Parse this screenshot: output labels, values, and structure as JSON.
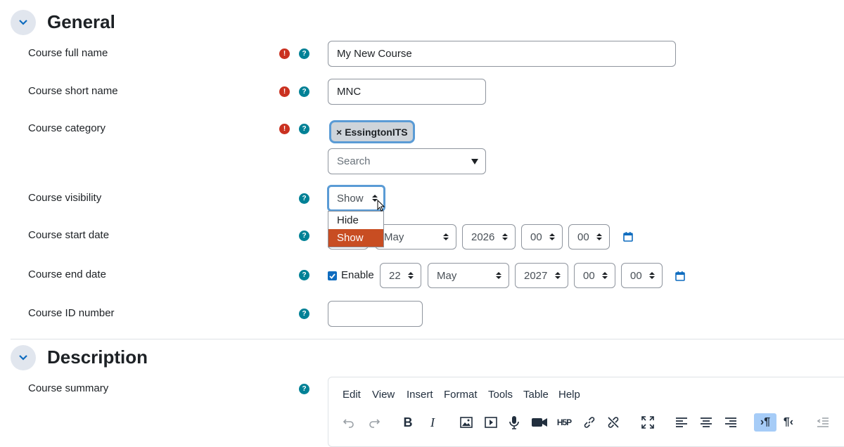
{
  "general": {
    "title": "General",
    "fields": {
      "fullname": {
        "label": "Course full name",
        "value": "My New Course"
      },
      "shortname": {
        "label": "Course short name",
        "value": "MNC"
      },
      "category": {
        "label": "Course category",
        "selected_badge": "EssingtonITS",
        "badge_remove": "×",
        "search_placeholder": "Search"
      },
      "visibility": {
        "label": "Course visibility",
        "value": "Show",
        "options": [
          "Hide",
          "Show"
        ],
        "highlighted_option": "Show"
      },
      "startdate": {
        "label": "Course start date",
        "month": "May",
        "year": "2026",
        "hour": "00",
        "minute": "00"
      },
      "enddate": {
        "label": "Course end date",
        "enable_label": "Enable",
        "enabled": true,
        "day": "22",
        "month": "May",
        "year": "2027",
        "hour": "00",
        "minute": "00"
      },
      "idnumber": {
        "label": "Course ID number",
        "value": ""
      }
    }
  },
  "description": {
    "title": "Description",
    "summary_label": "Course summary",
    "editor_menu": [
      "Edit",
      "View",
      "Insert",
      "Format",
      "Tools",
      "Table",
      "Help"
    ],
    "toolbar_icons": [
      "undo-icon",
      "redo-icon",
      "bold-icon",
      "italic-icon",
      "image-icon",
      "media-icon",
      "microphone-icon",
      "video-icon",
      "h5p-icon",
      "link-icon",
      "unlink-icon",
      "fullscreen-icon",
      "align-left-icon",
      "align-center-icon",
      "align-right-icon",
      "ltr-icon",
      "rtl-icon",
      "outdent-icon"
    ],
    "h5p_text": "H5P"
  },
  "icons": {
    "required": "!",
    "help": "?",
    "collapse": "chevron-down-icon",
    "calendar": "calendar-icon"
  },
  "colors": {
    "accent": "#0f6cbf",
    "required": "#ca3120",
    "help": "#008196",
    "highlight": "#c84d22",
    "focus_ring": "#5a9bd5"
  }
}
